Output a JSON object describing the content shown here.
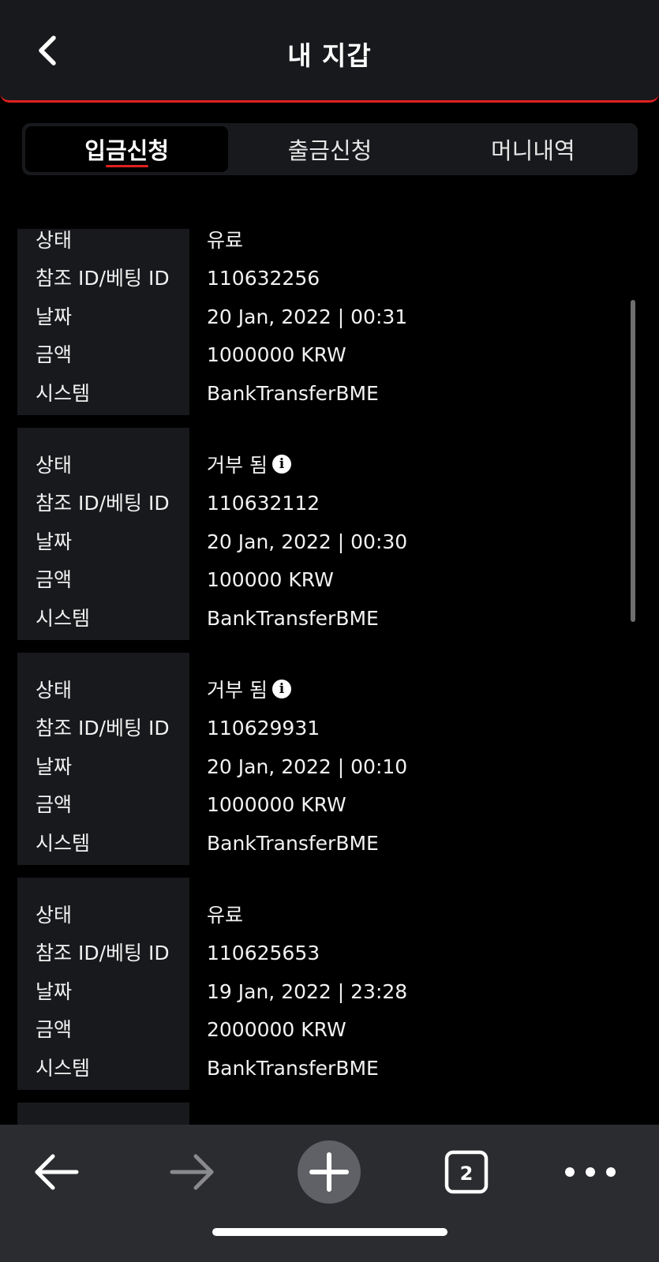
{
  "header": {
    "title": "내 지갑"
  },
  "tabs": [
    {
      "label": "입금신청",
      "active": true
    },
    {
      "label": "출금신청",
      "active": false
    },
    {
      "label": "머니내역",
      "active": false
    }
  ],
  "field_labels": {
    "status": "상태",
    "ref_id": "참조 ID/베팅 ID",
    "date": "날짜",
    "amount": "금액",
    "system": "시스템"
  },
  "records": [
    {
      "status": "유료",
      "ref_id": "110632256",
      "date": "20 Jan, 2022 | 00:31",
      "amount": "1000000 KRW",
      "system": "BankTransferBME",
      "info_icon": false
    },
    {
      "status": "거부 됨",
      "ref_id": "110632112",
      "date": "20 Jan, 2022 | 00:30",
      "amount": "100000 KRW",
      "system": "BankTransferBME",
      "info_icon": true
    },
    {
      "status": "거부 됨",
      "ref_id": "110629931",
      "date": "20 Jan, 2022 | 00:10",
      "amount": "1000000 KRW",
      "system": "BankTransferBME",
      "info_icon": true
    },
    {
      "status": "유료",
      "ref_id": "110625653",
      "date": "19 Jan, 2022 | 23:28",
      "amount": "2000000 KRW",
      "system": "BankTransferBME",
      "info_icon": false
    }
  ],
  "browser": {
    "tab_count": "2"
  },
  "colors": {
    "accent": "#e0201f",
    "surface": "#18191c",
    "background": "#000000",
    "toolbar": "#2b2c30"
  },
  "icons": {
    "back": "chevron-left-icon",
    "info": "info-icon",
    "browser_back": "arrow-left-icon",
    "browser_forward": "arrow-right-icon",
    "new_tab": "plus-icon",
    "tabs": "tab-count-icon",
    "more": "ellipsis-icon"
  }
}
